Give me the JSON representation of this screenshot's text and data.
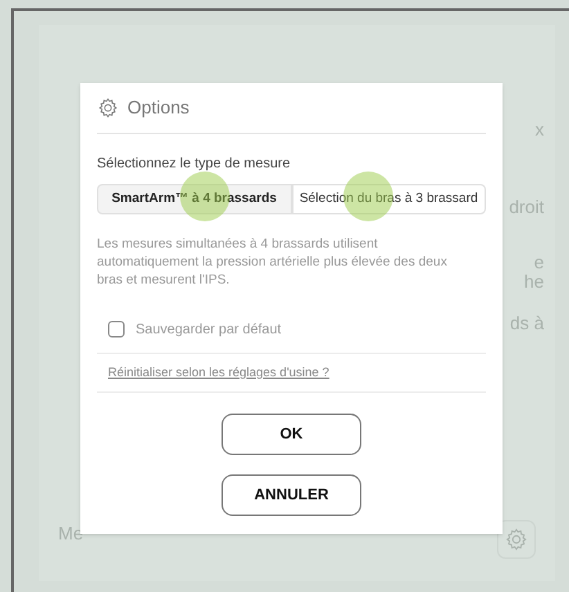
{
  "background": {
    "fragments": [
      "x",
      "droit",
      "e",
      "he",
      "ds à"
    ],
    "footer_text": "Me"
  },
  "dialog": {
    "title": "Options",
    "measure_label": "Sélectionnez le type de mesure",
    "segments": [
      {
        "label": "SmartArm™ à 4 brassards",
        "selected": true
      },
      {
        "label": "Sélection du bras à 3 brassard",
        "selected": false
      }
    ],
    "description": "Les mesures simultanées à 4 brassards utilisent automatiquement la pression artérielle plus élevée des deux bras et mesurent l'IPS.",
    "save_default": {
      "label": "Sauvegarder par défaut",
      "checked": false
    },
    "reset_link": "Réinitialiser selon les réglages d'usine ?",
    "buttons": [
      "OK",
      "ANNULER"
    ]
  }
}
